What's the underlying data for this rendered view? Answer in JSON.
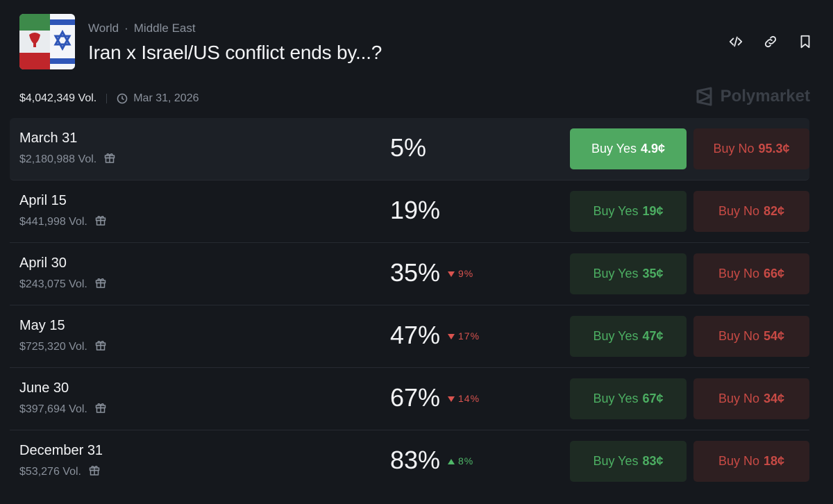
{
  "market": {
    "breadcrumb": [
      "World",
      "Middle East"
    ],
    "title": "Iran x Israel/US conflict ends by...?",
    "volume": "$4,042,349 Vol.",
    "end_date": "Mar 31, 2026",
    "brand": "Polymarket"
  },
  "icons": {
    "embed": "code-icon",
    "link": "link-icon",
    "bookmark": "bookmark-icon",
    "clock": "clock-icon",
    "gift": "gift-icon"
  },
  "colors": {
    "background": "#15181d",
    "yes": "#4cae62",
    "yes_active_bg": "#4fa861",
    "no": "#c84a45",
    "down": "#d9534f",
    "up": "#4fb768"
  },
  "outcomes": [
    {
      "name": "March 31",
      "volume": "$2,180,988 Vol.",
      "pct": "5%",
      "change": "",
      "direction": "",
      "yes_label": "Buy Yes",
      "yes_price": "4.9¢",
      "no_label": "Buy No",
      "no_price": "95.3¢"
    },
    {
      "name": "April 15",
      "volume": "$441,998 Vol.",
      "pct": "19%",
      "change": "",
      "direction": "",
      "yes_label": "Buy Yes",
      "yes_price": "19¢",
      "no_label": "Buy No",
      "no_price": "82¢"
    },
    {
      "name": "April 30",
      "volume": "$243,075 Vol.",
      "pct": "35%",
      "change": "9%",
      "direction": "down",
      "yes_label": "Buy Yes",
      "yes_price": "35¢",
      "no_label": "Buy No",
      "no_price": "66¢"
    },
    {
      "name": "May 15",
      "volume": "$725,320 Vol.",
      "pct": "47%",
      "change": "17%",
      "direction": "down",
      "yes_label": "Buy Yes",
      "yes_price": "47¢",
      "no_label": "Buy No",
      "no_price": "54¢"
    },
    {
      "name": "June 30",
      "volume": "$397,694 Vol.",
      "pct": "67%",
      "change": "14%",
      "direction": "down",
      "yes_label": "Buy Yes",
      "yes_price": "67¢",
      "no_label": "Buy No",
      "no_price": "34¢"
    },
    {
      "name": "December 31",
      "volume": "$53,276 Vol.",
      "pct": "83%",
      "change": "8%",
      "direction": "up",
      "yes_label": "Buy Yes",
      "yes_price": "83¢",
      "no_label": "Buy No",
      "no_price": "18¢"
    }
  ]
}
